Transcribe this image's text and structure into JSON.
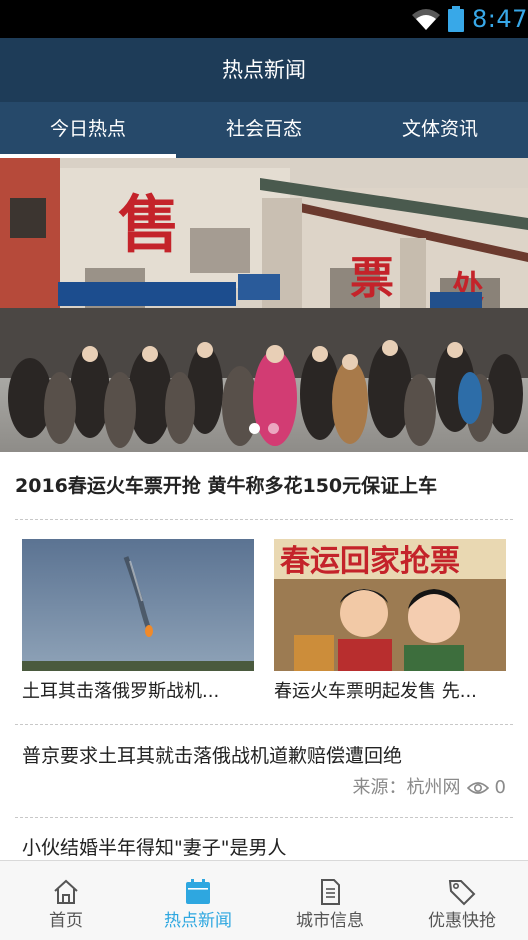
{
  "status_bar": {
    "time": "8:47",
    "icons": [
      "wifi-icon",
      "battery-icon"
    ]
  },
  "header": {
    "title": "热点新闻"
  },
  "tabs": [
    {
      "label": "今日热点",
      "active": true
    },
    {
      "label": "社会百态",
      "active": false
    },
    {
      "label": "文体资讯",
      "active": false
    }
  ],
  "banner": {
    "sign_text": [
      "售",
      "票",
      "处"
    ],
    "slides": 2,
    "active_slide": 1
  },
  "headline": {
    "title": "2016春运火车票开抢 黄牛称多花150元保证上车"
  },
  "image_news": [
    {
      "caption": "土耳其击落俄罗斯战机..."
    },
    {
      "caption": "春运火车票明起发售 先...",
      "poster_text": "春运回家抢票"
    }
  ],
  "text_news": [
    {
      "title": "普京要求土耳其就击落俄战机道歉赔偿遭回绝",
      "source": "来源：杭州网",
      "views": "0"
    },
    {
      "title": "小伙结婚半年得知\"妻子\"是男人"
    }
  ],
  "bottom_nav": [
    {
      "label": "首页",
      "icon": "home-icon",
      "active": false
    },
    {
      "label": "热点新闻",
      "icon": "calendar-icon",
      "active": true
    },
    {
      "label": "城市信息",
      "icon": "document-icon",
      "active": false
    },
    {
      "label": "优惠快抢",
      "icon": "tag-icon",
      "active": false
    }
  ],
  "colors": {
    "title_bar": "#1e3c58",
    "tab_bar": "#26496a",
    "status_accent": "#38a8e8",
    "nav_active": "#2ea7e0",
    "sign_red": "#c4232a"
  }
}
